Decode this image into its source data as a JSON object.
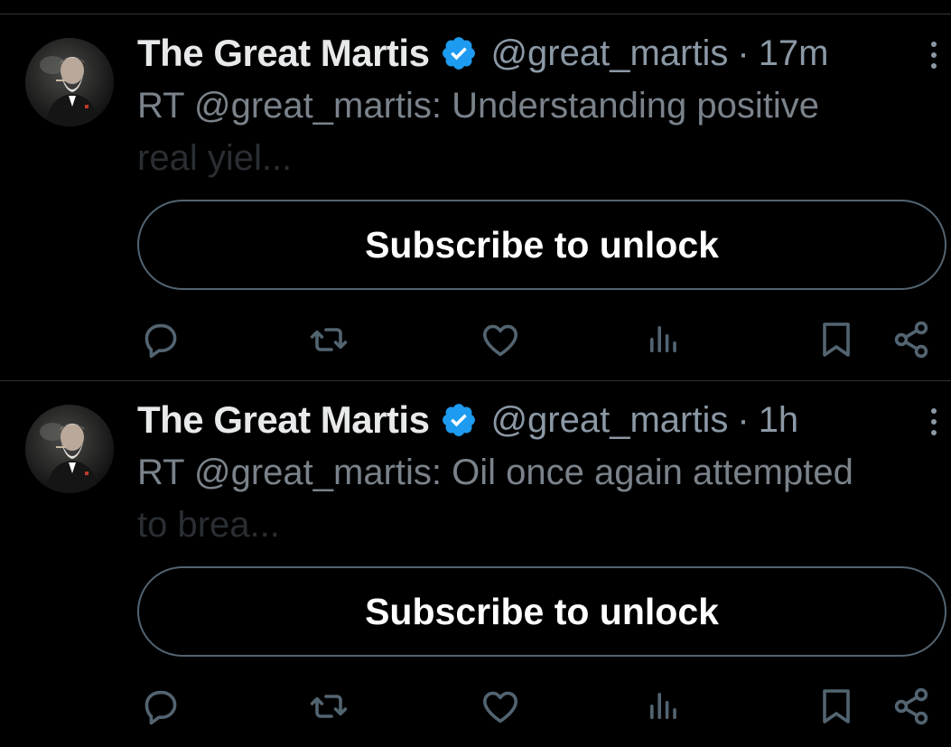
{
  "tweets": [
    {
      "author_name": "The Great Martis",
      "handle": "@great_martis",
      "separator": "·",
      "time": "17m",
      "text_line1": "RT @great_martis: Understanding positive",
      "text_line2": "real yiel...",
      "subscribe_label": "Subscribe to unlock"
    },
    {
      "author_name": "The Great Martis",
      "handle": "@great_martis",
      "separator": "·",
      "time": "1h",
      "text_line1": "RT @great_martis: Oil once again attempted",
      "text_line2": "to brea...",
      "subscribe_label": "Subscribe to unlock"
    }
  ],
  "colors": {
    "background": "#000000",
    "verified_badge": "#1d9bf0",
    "secondary_text": "#8b98a5",
    "icon": "#536471",
    "divider": "#2f3336"
  },
  "icons": [
    "more-icon",
    "verified-icon",
    "reply-icon",
    "retweet-icon",
    "like-icon",
    "views-icon",
    "bookmark-icon",
    "share-icon"
  ]
}
